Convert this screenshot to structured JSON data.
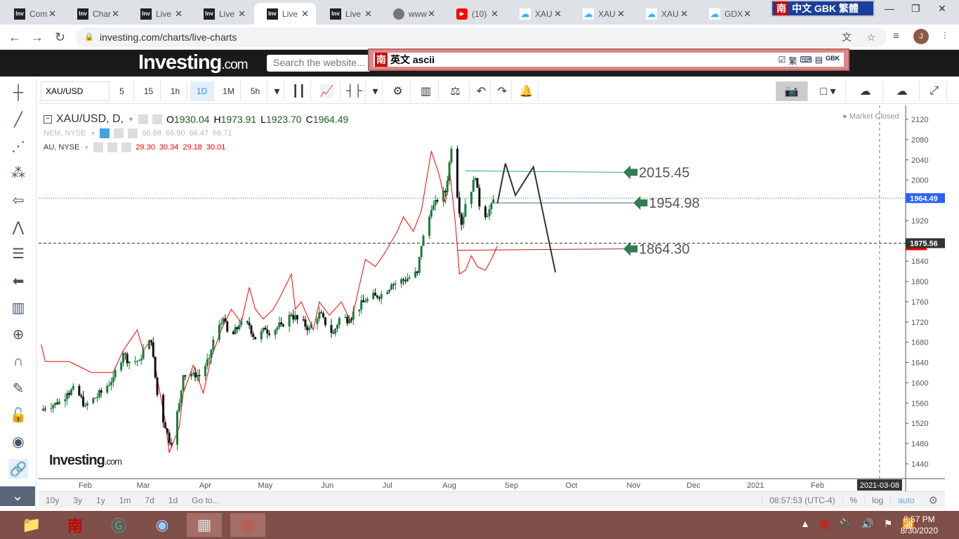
{
  "browser": {
    "tabs": [
      {
        "label": "Com",
        "icon": "inv"
      },
      {
        "label": "Char",
        "icon": "inv"
      },
      {
        "label": "Live",
        "icon": "inv"
      },
      {
        "label": "Live",
        "icon": "inv"
      },
      {
        "label": "Live",
        "icon": "inv",
        "active": true
      },
      {
        "label": "Live",
        "icon": "inv"
      },
      {
        "label": "www",
        "icon": "globe"
      },
      {
        "label": "(10)",
        "icon": "youtube"
      },
      {
        "label": "XAU",
        "icon": "cloud"
      },
      {
        "label": "XAU",
        "icon": "cloud"
      },
      {
        "label": "XAU",
        "icon": "cloud"
      },
      {
        "label": "GDX",
        "icon": "cloud"
      }
    ],
    "url": "investing.com/charts/live-charts",
    "profile": "J"
  },
  "ime": {
    "top_label": "中文 GBK 繁體",
    "top_icon": "南",
    "bar_icon": "南",
    "bar_text": "英文 ascii",
    "trad": "繁",
    "gbk": "GBK"
  },
  "site": {
    "logo": "Investing",
    "logo_suffix": ".com",
    "search_placeholder": "Search the website..."
  },
  "toolbar": {
    "symbol": "XAU/USD",
    "intervals": [
      "5",
      "15",
      "1h",
      "1D",
      "1M",
      "5h"
    ],
    "active_interval": "1D"
  },
  "legend": {
    "main": {
      "title": "XAU/USD, D,",
      "o_label": "O",
      "o": "1930.04",
      "h_label": "H",
      "h": "1973.91",
      "l_label": "L",
      "l": "1923.70",
      "c_label": "C",
      "c": "1964.49"
    },
    "nem": {
      "title": "NEM, NYSE",
      "values": [
        "66.88",
        "66.90",
        "66.47",
        "66.71"
      ]
    },
    "au": {
      "title": "AU, NYSE",
      "values": [
        "29.30",
        "30.34",
        "29.18",
        "30.01"
      ]
    }
  },
  "market_status": "Market Closed",
  "watermark": "Investing.com",
  "chart_data": {
    "type": "candlestick",
    "title": "XAU/USD, D",
    "x_unit": "day of year 2020",
    "ylim": [
      1420,
      2140
    ],
    "y_ticks": [
      2120,
      2080,
      2040,
      2000,
      1960,
      1920,
      1880,
      1840,
      1800,
      1760,
      1720,
      1680,
      1640,
      1600,
      1560,
      1520,
      1480,
      1440
    ],
    "x_ticks": [
      {
        "label": "Feb",
        "day": 35
      },
      {
        "label": "Mar",
        "day": 64
      },
      {
        "label": "Apr",
        "day": 95
      },
      {
        "label": "May",
        "day": 125
      },
      {
        "label": "Jun",
        "day": 156
      },
      {
        "label": "Jul",
        "day": 186
      },
      {
        "label": "Aug",
        "day": 217
      },
      {
        "label": "Sep",
        "day": 248
      },
      {
        "label": "Oct",
        "day": 278
      },
      {
        "label": "Nov",
        "day": 309
      },
      {
        "label": "Dec",
        "day": 339
      },
      {
        "label": "2021",
        "day": 370
      },
      {
        "label": "Feb",
        "day": 401
      }
    ],
    "xau_close": [
      [
        13,
        1545
      ],
      [
        16,
        1557
      ],
      [
        21,
        1558
      ],
      [
        26,
        1580
      ],
      [
        30,
        1587
      ],
      [
        35,
        1555
      ],
      [
        40,
        1570
      ],
      [
        44,
        1584
      ],
      [
        49,
        1611
      ],
      [
        54,
        1658
      ],
      [
        57,
        1642
      ],
      [
        62,
        1644
      ],
      [
        65,
        1673
      ],
      [
        68,
        1680
      ],
      [
        71,
        1576
      ],
      [
        75,
        1510
      ],
      [
        78,
        1478
      ],
      [
        82,
        1560
      ],
      [
        84,
        1615
      ],
      [
        89,
        1620
      ],
      [
        92,
        1613
      ],
      [
        97,
        1649
      ],
      [
        99,
        1685
      ],
      [
        104,
        1727
      ],
      [
        107,
        1683
      ],
      [
        112,
        1714
      ],
      [
        117,
        1713
      ],
      [
        120,
        1686
      ],
      [
        125,
        1705
      ],
      [
        128,
        1702
      ],
      [
        133,
        1715
      ],
      [
        138,
        1734
      ],
      [
        141,
        1725
      ],
      [
        147,
        1708
      ],
      [
        152,
        1739
      ],
      [
        155,
        1714
      ],
      [
        159,
        1697
      ],
      [
        162,
        1728
      ],
      [
        167,
        1726
      ],
      [
        170,
        1744
      ],
      [
        175,
        1761
      ],
      [
        180,
        1772
      ],
      [
        183,
        1775
      ],
      [
        188,
        1794
      ],
      [
        191,
        1798
      ],
      [
        196,
        1806
      ],
      [
        201,
        1817
      ],
      [
        203,
        1870
      ],
      [
        205,
        1902
      ],
      [
        208,
        1941
      ],
      [
        211,
        1958
      ],
      [
        215,
        1976
      ],
      [
        218,
        2062
      ],
      [
        219,
        2035
      ],
      [
        223,
        1912
      ],
      [
        225,
        1953
      ],
      [
        230,
        2004
      ],
      [
        232,
        1948
      ],
      [
        236,
        1929
      ],
      [
        238,
        1954
      ],
      [
        240,
        1964
      ]
    ],
    "au_series": {
      "name": "AU, NYSE",
      "color": "#ff0000",
      "scale": {
        "offset": 1150,
        "factor": 24
      },
      "points": [
        [
          13,
          21.9
        ],
        [
          15,
          20.5
        ],
        [
          27,
          20.5
        ],
        [
          38,
          19.6
        ],
        [
          49,
          19.6
        ],
        [
          54,
          21.4
        ],
        [
          61,
          23.1
        ],
        [
          64,
          21.4
        ],
        [
          68,
          22.3
        ],
        [
          71,
          19.1
        ],
        [
          75,
          15.6
        ],
        [
          77,
          13.0
        ],
        [
          82,
          15.1
        ],
        [
          84,
          17.9
        ],
        [
          89,
          20.2
        ],
        [
          94,
          17.9
        ],
        [
          98,
          20.8
        ],
        [
          103,
          23.1
        ],
        [
          108,
          24.8
        ],
        [
          113,
          23.7
        ],
        [
          117,
          26.6
        ],
        [
          120,
          24.8
        ],
        [
          124,
          24.0
        ],
        [
          129,
          24.8
        ],
        [
          133,
          26.0
        ],
        [
          138,
          27.7
        ],
        [
          140,
          24.8
        ],
        [
          143,
          25.4
        ],
        [
          149,
          23.1
        ],
        [
          152,
          25.4
        ],
        [
          157,
          24.3
        ],
        [
          163,
          25.4
        ],
        [
          168,
          23.7
        ],
        [
          171,
          26.0
        ],
        [
          175,
          28.9
        ],
        [
          180,
          28.3
        ],
        [
          185,
          29.5
        ],
        [
          191,
          31.2
        ],
        [
          194,
          32.4
        ],
        [
          199,
          31.2
        ],
        [
          203,
          32.9
        ],
        [
          208,
          37.8
        ],
        [
          212,
          35.8
        ],
        [
          215,
          33.5
        ],
        [
          217,
          36.4
        ],
        [
          220,
          31.9
        ],
        [
          222,
          27.7
        ],
        [
          225,
          28.0
        ],
        [
          228,
          29.2
        ],
        [
          231,
          28.3
        ],
        [
          235,
          28.0
        ],
        [
          238,
          28.9
        ],
        [
          241,
          30.0
        ]
      ]
    },
    "price_lines": [
      {
        "label": "1964.49",
        "value": 1964.49,
        "color": "#2962ff",
        "style": "dotted"
      },
      {
        "label": "1875.56",
        "value": 1875.56,
        "color": "#333333",
        "style": "dashed"
      }
    ],
    "annotations": [
      {
        "label": "2015.45",
        "value": 2015.45,
        "from_day": 225,
        "to_day": 304,
        "color": "#26a69a"
      },
      {
        "label": "1954.98",
        "value": 1954.98,
        "from_day": 239,
        "to_day": 309,
        "color": "#3a6f8f"
      },
      {
        "label": "1864.30",
        "value": 1864.3,
        "from_day": 221,
        "to_day": 304,
        "color": "#b71c1c"
      }
    ],
    "zigzag": [
      [
        241,
        1954
      ],
      [
        245,
        2033
      ],
      [
        250,
        1970
      ],
      [
        259,
        2026
      ],
      [
        270,
        1818
      ]
    ],
    "crosshair": {
      "label": "2021-03-08",
      "day": 432
    }
  },
  "bottom": {
    "ranges": [
      "10y",
      "3y",
      "1y",
      "1m",
      "7d",
      "1d",
      "Go to..."
    ],
    "time": "08:57:53 (UTC-4)",
    "percent": "%",
    "log": "log",
    "auto": "auto"
  },
  "taskbar": {
    "time": "8:57 PM",
    "date": "8/30/2020"
  }
}
